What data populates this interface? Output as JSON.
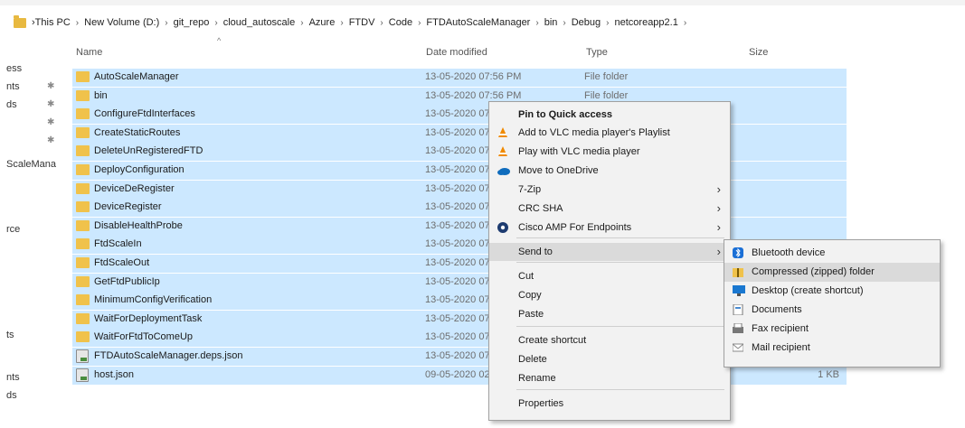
{
  "breadcrumb": [
    "This PC",
    "New Volume (D:)",
    "git_repo",
    "cloud_autoscale",
    "Azure",
    "FTDV",
    "Code",
    "FTDAutoScaleManager",
    "bin",
    "Debug",
    "netcoreapp2.1"
  ],
  "nav": [
    {
      "label": "ess",
      "pinned": false
    },
    {
      "label": "nts",
      "pinned": true
    },
    {
      "label": "ds",
      "pinned": true
    },
    {
      "label": "",
      "pinned": true
    },
    {
      "label": "",
      "pinned": true
    },
    {
      "label": "ScaleMana",
      "pinned": false
    },
    {
      "label": "rce",
      "pinned": false
    },
    {
      "label": "ts",
      "pinned": false
    },
    {
      "label": "nts",
      "pinned": false
    },
    {
      "label": "ds",
      "pinned": false
    }
  ],
  "columns": {
    "name": "Name",
    "date": "Date modified",
    "type": "Type",
    "size": "Size"
  },
  "rows": [
    {
      "name": "AutoScaleManager",
      "date": "13-05-2020 07:56 PM",
      "type": "File folder",
      "size": "",
      "kind": "folder"
    },
    {
      "name": "bin",
      "date": "13-05-2020 07:56 PM",
      "type": "File folder",
      "size": "",
      "kind": "folder"
    },
    {
      "name": "ConfigureFtdInterfaces",
      "date": "13-05-2020 07",
      "type": "",
      "size": "",
      "kind": "folder"
    },
    {
      "name": "CreateStaticRoutes",
      "date": "13-05-2020 07",
      "type": "",
      "size": "",
      "kind": "folder"
    },
    {
      "name": "DeleteUnRegisteredFTD",
      "date": "13-05-2020 07",
      "type": "",
      "size": "",
      "kind": "folder"
    },
    {
      "name": "DeployConfiguration",
      "date": "13-05-2020 07",
      "type": "",
      "size": "",
      "kind": "folder"
    },
    {
      "name": "DeviceDeRegister",
      "date": "13-05-2020 07",
      "type": "",
      "size": "",
      "kind": "folder"
    },
    {
      "name": "DeviceRegister",
      "date": "13-05-2020 07",
      "type": "",
      "size": "",
      "kind": "folder"
    },
    {
      "name": "DisableHealthProbe",
      "date": "13-05-2020 07",
      "type": "",
      "size": "",
      "kind": "folder"
    },
    {
      "name": "FtdScaleIn",
      "date": "13-05-2020 07",
      "type": "",
      "size": "",
      "kind": "folder"
    },
    {
      "name": "FtdScaleOut",
      "date": "13-05-2020 07",
      "type": "",
      "size": "",
      "kind": "folder"
    },
    {
      "name": "GetFtdPublicIp",
      "date": "13-05-2020 07",
      "type": "",
      "size": "",
      "kind": "folder"
    },
    {
      "name": "MinimumConfigVerification",
      "date": "13-05-2020 07",
      "type": "",
      "size": "",
      "kind": "folder"
    },
    {
      "name": "WaitForDeploymentTask",
      "date": "13-05-2020 07",
      "type": "",
      "size": "",
      "kind": "folder"
    },
    {
      "name": "WaitForFtdToComeUp",
      "date": "13-05-2020 07",
      "type": "",
      "size": "",
      "kind": "folder"
    },
    {
      "name": "FTDAutoScaleManager.deps.json",
      "date": "13-05-2020 07",
      "type": "",
      "size": "",
      "kind": "file"
    },
    {
      "name": "host.json",
      "date": "09-05-2020 02",
      "type": "",
      "size": "1 KB",
      "kind": "file"
    }
  ],
  "context_menu": [
    {
      "label": "Pin to Quick access",
      "bold": true,
      "icon": "",
      "submenu": false
    },
    {
      "label": "Add to VLC media player's Playlist",
      "icon": "vlc-icon",
      "submenu": false
    },
    {
      "label": "Play with VLC media player",
      "icon": "vlc-icon",
      "submenu": false
    },
    {
      "label": "Move to OneDrive",
      "icon": "onedrive-icon",
      "submenu": false
    },
    {
      "label": "7-Zip",
      "icon": "",
      "submenu": true
    },
    {
      "label": "CRC SHA",
      "icon": "",
      "submenu": true
    },
    {
      "label": "Cisco AMP For Endpoints",
      "icon": "cisco-amp-icon",
      "submenu": true
    },
    {
      "label": "Send to",
      "icon": "",
      "submenu": true,
      "highlighted": true
    },
    {
      "label": "Cut",
      "icon": "",
      "submenu": false
    },
    {
      "label": "Copy",
      "icon": "",
      "submenu": false
    },
    {
      "label": "Paste",
      "icon": "",
      "submenu": false
    },
    {
      "label": "Create shortcut",
      "icon": "",
      "submenu": false
    },
    {
      "label": "Delete",
      "icon": "",
      "submenu": false
    },
    {
      "label": "Rename",
      "icon": "",
      "submenu": false
    },
    {
      "label": "Properties",
      "icon": "",
      "submenu": false
    }
  ],
  "send_to_menu": [
    {
      "label": "Bluetooth device",
      "icon": "bluetooth-icon"
    },
    {
      "label": "Compressed (zipped) folder",
      "icon": "zip-folder-icon",
      "highlighted": true
    },
    {
      "label": "Desktop (create shortcut)",
      "icon": "desktop-icon"
    },
    {
      "label": "Documents",
      "icon": "documents-icon"
    },
    {
      "label": "Fax recipient",
      "icon": "fax-icon"
    },
    {
      "label": "Mail recipient",
      "icon": "mail-icon"
    }
  ],
  "colors": {
    "selection": "#cce8ff",
    "folder": "#f0c24b",
    "menu_bg": "#f2f2f2",
    "menu_highlight": "#dadada"
  }
}
